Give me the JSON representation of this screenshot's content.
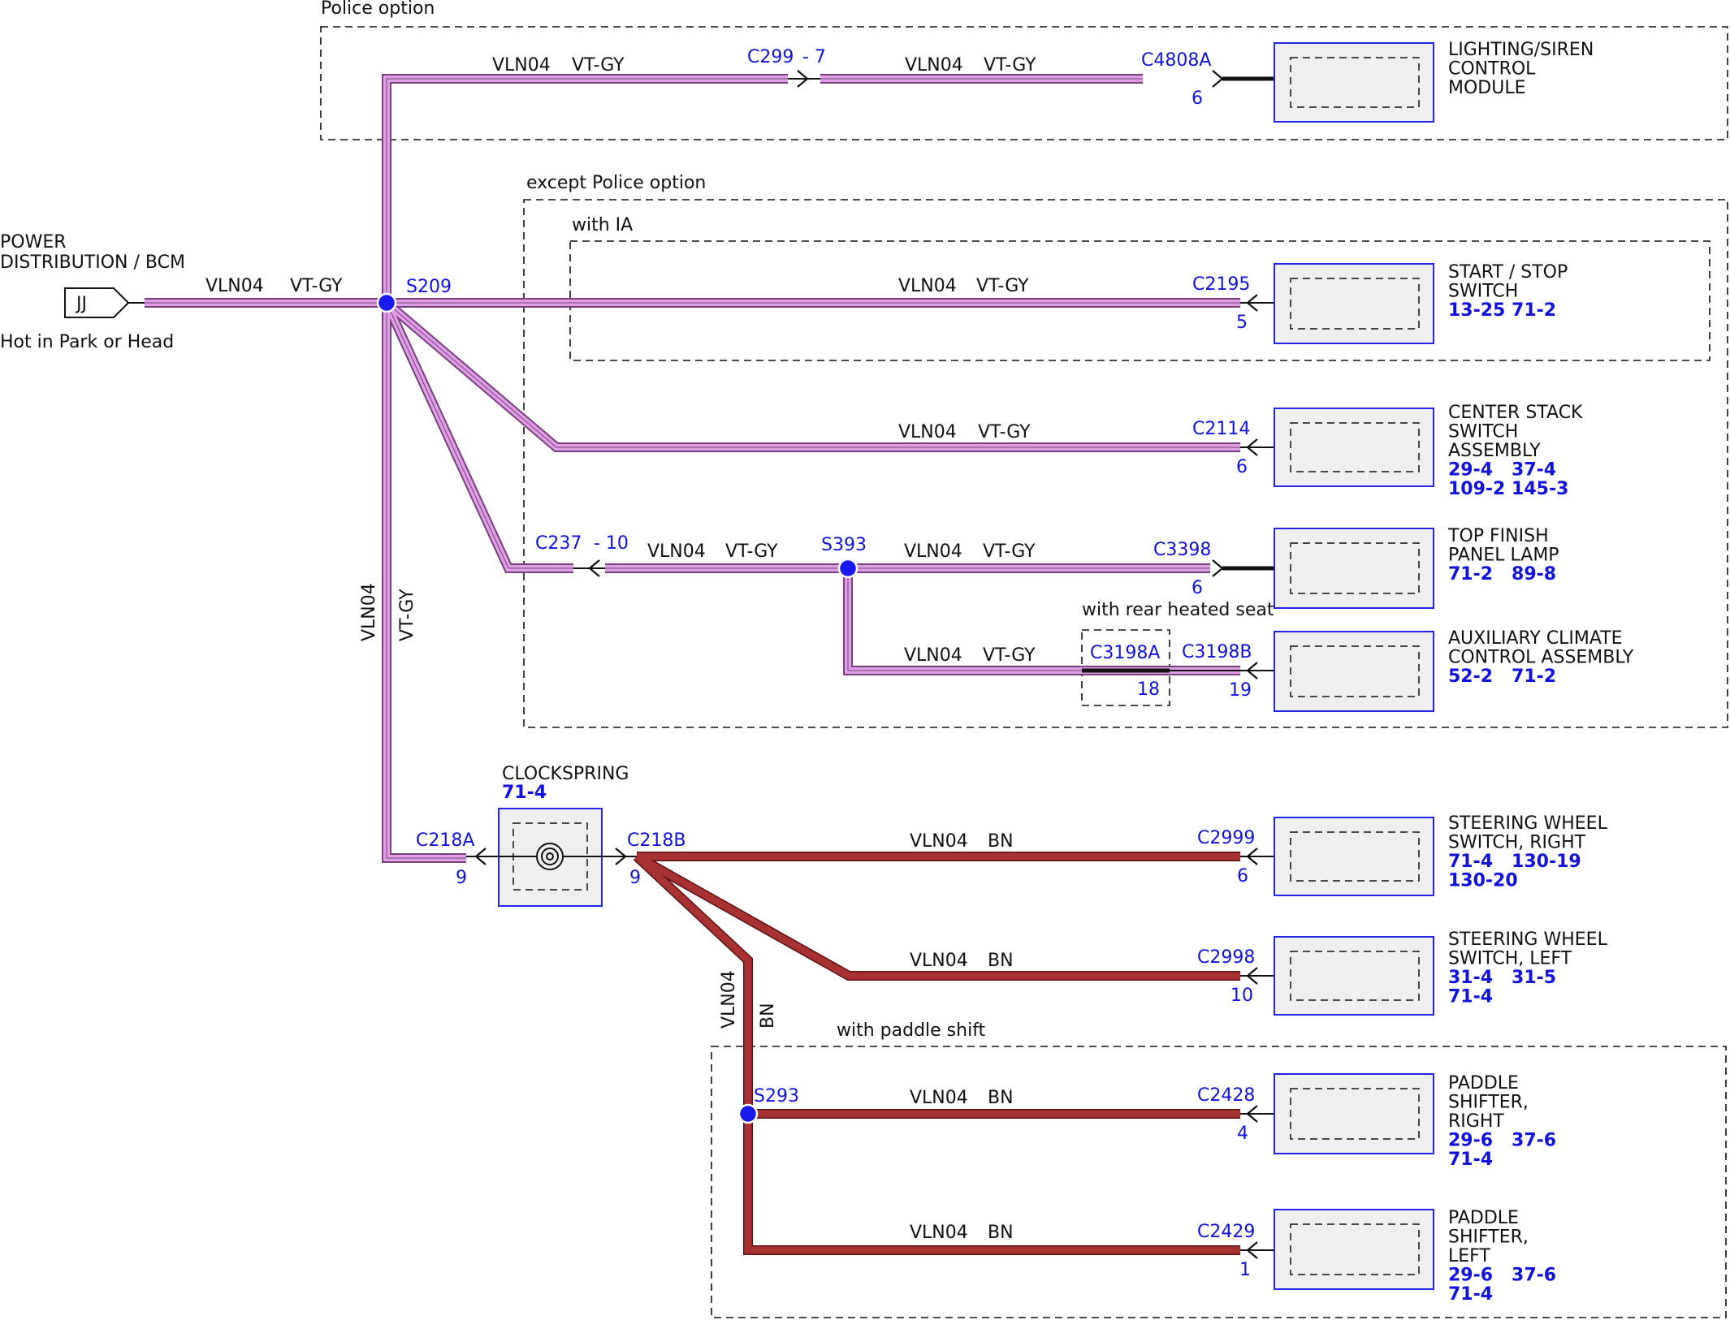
{
  "power_source": {
    "name_line1": "POWER",
    "name_line2": "DISTRIBUTION / BCM",
    "pin": "JJ",
    "note": "Hot in Park or Head"
  },
  "regions": {
    "police": "Police option",
    "except_police": "except Police option",
    "with_ia": "with IA",
    "rear_heated_seat": "with rear heated seat",
    "paddle_shift": "with paddle shift"
  },
  "circuits": {
    "main_circuit": "VLN04",
    "main_color": "VT-GY",
    "steering_circuit": "VLN04",
    "steering_color": "BN"
  },
  "splices": {
    "s209": "S209",
    "s393": "S393",
    "s293": "S293"
  },
  "inline_connectors": {
    "c299": "C299",
    "c299_pin": "- 7",
    "c237": "C237",
    "c237_pin": "- 10",
    "c218a": "C218A",
    "c218a_pin": "9",
    "c218b": "C218B",
    "c218b_pin": "9",
    "c3198a": "C3198A",
    "c3198a_pin": "18"
  },
  "clockspring": {
    "name": "CLOCKSPRING",
    "ref": "71-4"
  },
  "components": [
    {
      "connector": "C4808A",
      "pin": "6",
      "lines": [
        "LIGHTING/SIREN",
        "CONTROL",
        "MODULE"
      ],
      "refs": []
    },
    {
      "connector": "C2195",
      "pin": "5",
      "lines": [
        "START / STOP",
        "SWITCH"
      ],
      "refs": [
        "13-25 71-2"
      ]
    },
    {
      "connector": "C2114",
      "pin": "6",
      "lines": [
        "CENTER STACK",
        "SWITCH",
        "ASSEMBLY"
      ],
      "refs": [
        "29-4   37-4",
        "109-2 145-3"
      ]
    },
    {
      "connector": "C3398",
      "pin": "6",
      "lines": [
        "TOP FINISH",
        "PANEL LAMP"
      ],
      "refs": [
        "71-2   89-8"
      ]
    },
    {
      "connector": "C3198B",
      "pin": "19",
      "lines": [
        "AUXILIARY CLIMATE",
        "CONTROL ASSEMBLY"
      ],
      "refs": [
        "52-2   71-2"
      ]
    },
    {
      "connector": "C2999",
      "pin": "6",
      "lines": [
        "STEERING WHEEL",
        "SWITCH, RIGHT"
      ],
      "refs": [
        "71-4   130-19",
        "130-20"
      ]
    },
    {
      "connector": "C2998",
      "pin": "10",
      "lines": [
        "STEERING WHEEL",
        "SWITCH, LEFT"
      ],
      "refs": [
        "31-4   31-5",
        "71-4"
      ]
    },
    {
      "connector": "C2428",
      "pin": "4",
      "lines": [
        "PADDLE",
        "SHIFTER,",
        "RIGHT"
      ],
      "refs": [
        "29-6   37-6",
        "71-4"
      ]
    },
    {
      "connector": "C2429",
      "pin": "1",
      "lines": [
        "PADDLE",
        "SHIFTER,",
        "LEFT"
      ],
      "refs": [
        "29-6   37-6",
        "71-4"
      ]
    }
  ]
}
